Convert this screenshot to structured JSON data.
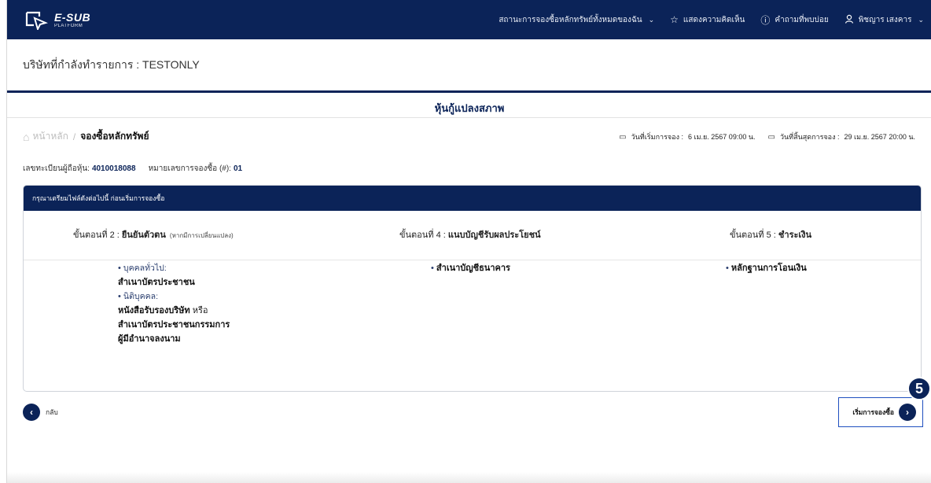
{
  "header": {
    "logo_title": "E-SUB",
    "logo_sub": "PLATFORM",
    "nav": {
      "status_label": "สถานะการจองซื้อหลักทรัพย์ทั้งหมดของฉัน",
      "feedback_label": "แสดงความคิดเห็น",
      "faq_label": "คำถามที่พบบ่อย",
      "user_label": "พิชญาร เสงคาร"
    }
  },
  "company": {
    "label": "บริษัทที่กำลังทำรายการ : TESTONLY"
  },
  "page": {
    "title": "หุ้นกู้แปลงสภาพ"
  },
  "breadcrumb": {
    "home": "หน้าหลัก",
    "separator": "/",
    "current": "จองซื้อหลักทรัพย์"
  },
  "dates": {
    "start_label": "วันที่เริ่มการจอง :",
    "start_value": "6 เม.ย. 2567 09:00 น.",
    "end_label": "วันที่สิ้นสุดการจอง :",
    "end_value": "29 เม.ย. 2567 20:00 น."
  },
  "account": {
    "holder_label": "เลขทะเบียนผู้ถือหุ้น:",
    "holder_value": "4010018088",
    "sub_label": "หมายเลขการจองซื้อ (#):",
    "sub_value": "01"
  },
  "panel": {
    "header": "กรุณาเตรียมไฟล์ดังต่อไปนี้ ก่อนเริ่มการจองซื้อ",
    "steps": [
      {
        "prefix": "ขั้นตอนที่ 2 :",
        "name": "ยืนยันตัวตน",
        "note": "(หากมีการเปลี่ยนแปลง)"
      },
      {
        "prefix": "ขั้นตอนที่ 4 :",
        "name": "แนบบัญชีรับผลประโยชน์",
        "note": ""
      },
      {
        "prefix": "ขั้นตอนที่ 5 :",
        "name": "ชำระเงิน",
        "note": ""
      }
    ],
    "col1": {
      "cat1": "บุคคลทั่วไป:",
      "item1": "สำเนาบัตรประชาชน",
      "cat2": "นิติบุคคล:",
      "item2a": "หนังสือรับรองบริษัท",
      "item2a_suffix": " หรือ",
      "item2b": "สำเนาบัตรประชาชนกรรมการ",
      "item2c": "ผู้มีอำนาจลงนาม"
    },
    "col2": {
      "item": "สำเนาบัญชีธนาคาร"
    },
    "col3": {
      "item": "หลักฐานการโอนเงิน"
    }
  },
  "actions": {
    "back_label": "กลับ",
    "start_label": "เริ่มการจองซื้อ",
    "step_badge": "5"
  },
  "colors": {
    "primary": "#0b2358",
    "highlight_border": "#1e4fbf"
  }
}
